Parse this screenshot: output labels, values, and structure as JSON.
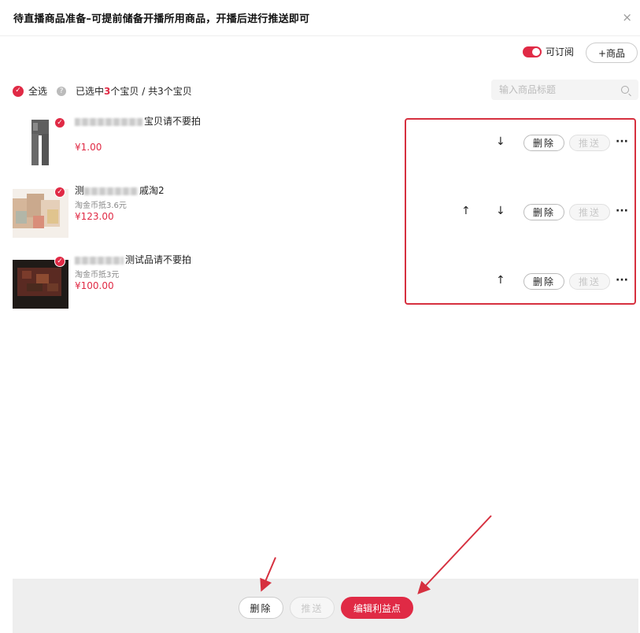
{
  "header": {
    "title": "待直播商品准备–可提前储备开播所用商品，开播后进行推送即可",
    "close_icon": "×"
  },
  "toolbar": {
    "subscribe_label": "可订阅",
    "subscribe_on": true,
    "add_product_label": "+商品"
  },
  "selection": {
    "select_all_label": "全选",
    "selected_prefix": "已选中",
    "selected_count": "3",
    "selected_suffix": "个宝贝 / 共3个宝贝"
  },
  "search": {
    "placeholder": "输入商品标题",
    "value": ""
  },
  "products": [
    {
      "name_visible": "宝贝请不要拍",
      "sub": "",
      "price": "¥1.00",
      "actions": {
        "up": "",
        "down": "↓",
        "delete": "删除",
        "push": "推送",
        "more": "···"
      }
    },
    {
      "name_visible": "测",
      "name_visible_end": "戚淘2",
      "sub": "淘金币抵3.6元",
      "price": "¥123.00",
      "actions": {
        "up": "↑",
        "down": "↓",
        "delete": "删除",
        "push": "推送",
        "more": "···"
      }
    },
    {
      "name_visible": "测试品请不要拍",
      "sub": "淘金币抵3元",
      "price": "¥100.00",
      "actions": {
        "up": "↑",
        "down": "",
        "delete": "删除",
        "push": "推送",
        "more": "···"
      }
    }
  ],
  "footer": {
    "delete_label": "删除",
    "push_label": "推送",
    "edit_label": "编辑利益点"
  },
  "colors": {
    "accent": "#e02a45",
    "annotation": "#d6303f"
  },
  "icons": {
    "close": "close-icon",
    "search": "search-icon",
    "check": "check-icon",
    "help": "help-icon",
    "up": "arrow-up-icon",
    "down": "arrow-down-icon",
    "more": "more-icon"
  }
}
